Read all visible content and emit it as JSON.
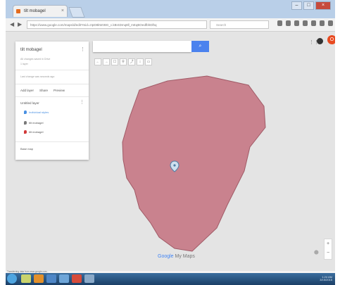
{
  "browser": {
    "tab_title": "tilt mobagel",
    "tab_close": "×",
    "new_tab": "+",
    "window_controls": {
      "minimize": "–",
      "maximize": "□",
      "close": "×"
    },
    "back": "◀",
    "forward": "▶",
    "url": "https://www.google.com/maps/d/edit?mid=zIpD8kWzBG_c.kBr4Dmq8ll_mEqBOedfbhDlhq",
    "search_placeholder": "Search"
  },
  "map": {
    "panel": {
      "title": "tilt mobagel",
      "menu": "⋮",
      "subtitle_1": "All changes saved in Drive",
      "subtitle_2": "1 layer",
      "subtitle_3": "Last change was seconds ago",
      "tools": [
        "Add layer",
        "Share",
        "Preview"
      ],
      "layer": {
        "title": "Untitled layer",
        "menu": "⋮",
        "items": [
          {
            "label": "Individual styles",
            "color": "#4a90e2"
          },
          {
            "label": "tilt mobagel",
            "color": "#7a7a7a"
          },
          {
            "label": "tilt mobagel",
            "color": "#d23a3a"
          }
        ]
      },
      "base_map": "Base map"
    },
    "search_button": "⌕",
    "toolbar_icons": [
      "←",
      "→",
      "☐",
      "⚲",
      "⤴",
      "↕",
      "▭"
    ],
    "apps_icon": "⋮⋮",
    "avatar_letter": "O",
    "logo_brand": "Google",
    "logo_product": " My Maps",
    "zoom_in": "+",
    "zoom_out": "−",
    "polygon_color": "#c9828e"
  },
  "status_text": "Transferring data from www.google.com...",
  "taskbar": {
    "clock_time": "1:24 AM",
    "clock_date": "3/15/2015"
  }
}
